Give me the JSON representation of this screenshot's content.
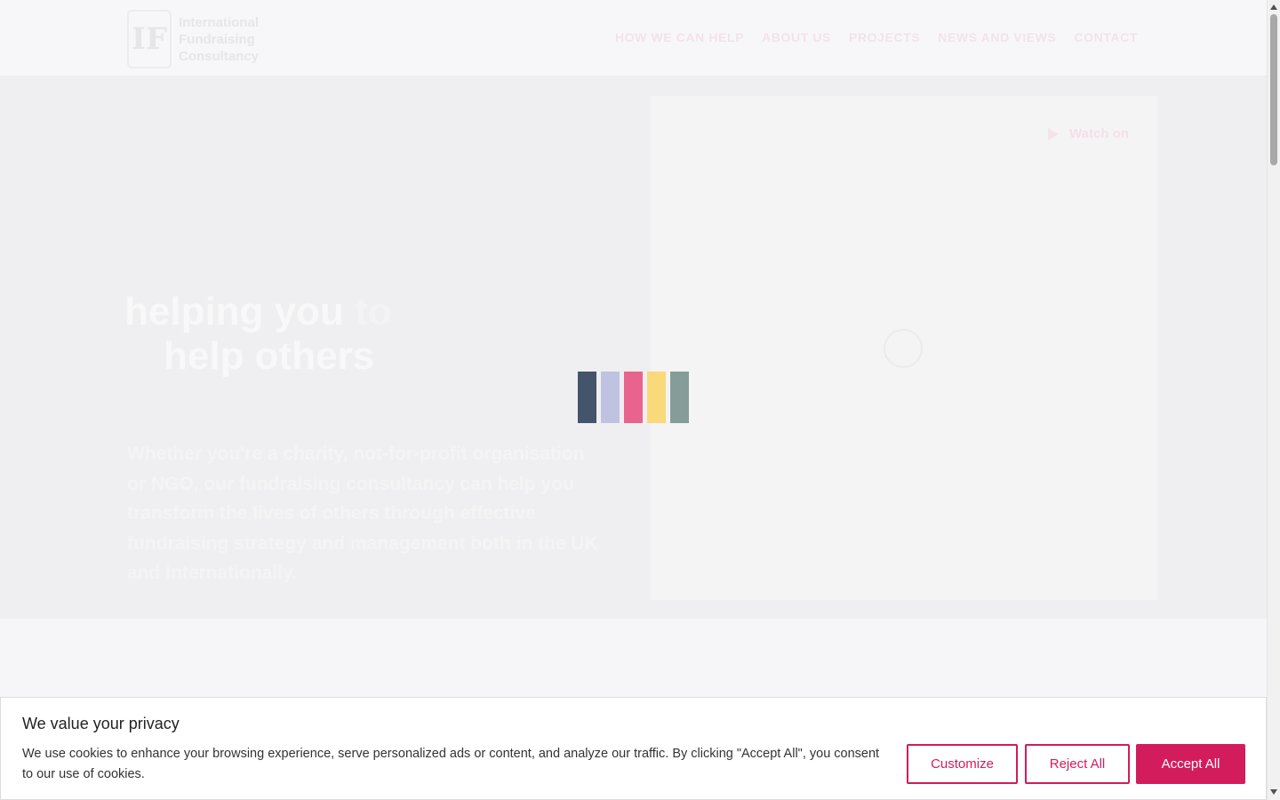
{
  "header": {
    "logo": {
      "mark": "IF",
      "lines": [
        "International",
        "Fundraising",
        "Consultancy"
      ]
    },
    "nav": [
      "HOW WE CAN HELP",
      "ABOUT US",
      "PROJECTS",
      "NEWS AND VIEWS",
      "CONTACT"
    ]
  },
  "hero": {
    "title_part1": "helping you",
    "title_accent": "to",
    "title_line2": "help others",
    "text": "Whether you're a charity, not-for-profit organisation or NGO, our fundraising consultancy can help you transform the lives of others through effective fundraising strategy and management both in the UK and internationally.",
    "video_link": "Watch on"
  },
  "loader": {
    "colors": [
      "#44546a",
      "#bfc3e1",
      "#e8648f",
      "#f9d97a",
      "#869c98"
    ]
  },
  "cookie": {
    "title": "We value your privacy",
    "text": "We use cookies to enhance your browsing experience, serve personalized ads or content, and analyze our traffic. By clicking \"Accept All\", you consent to our use of cookies.",
    "customize_label": "Customize",
    "reject_label": "Reject All",
    "accept_label": "Accept All",
    "accent_color": "#d21c5b"
  }
}
